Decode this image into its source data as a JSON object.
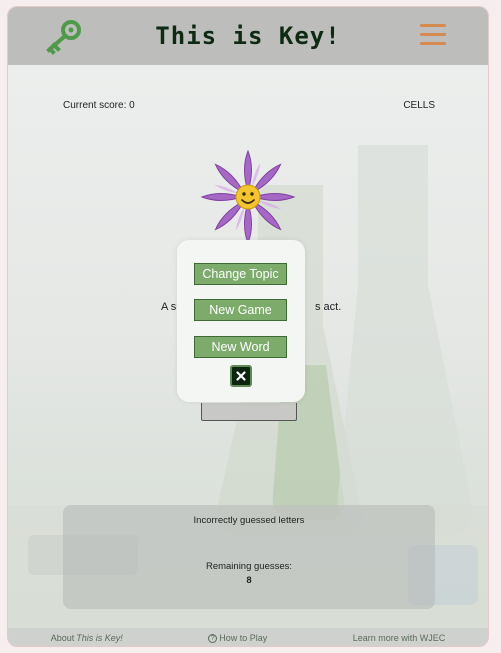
{
  "header": {
    "title": "This is Key!",
    "logo_icon": "key-icon",
    "menu_icon": "hamburger-menu-icon",
    "accent_color": "#d58a4f",
    "logo_color": "#4f9a4a"
  },
  "status": {
    "score_label": "Current score: 0",
    "topic": "CELLS"
  },
  "hint": {
    "visible_start": "A sub",
    "visible_end": "s act."
  },
  "modal": {
    "change_topic": "Change Topic",
    "new_game": "New Game",
    "new_word": "New Word",
    "close_icon": "close-icon",
    "button_color": "#7dab6b"
  },
  "guesses": {
    "incorrect_label": "Incorrectly guessed letters",
    "remaining_label": "Remaining guesses:",
    "remaining_value": "8"
  },
  "footer": {
    "about_prefix": "About ",
    "about_name": "This is Key!",
    "how_to_play": "How to Play",
    "learn_more": "Learn more with WJEC"
  }
}
